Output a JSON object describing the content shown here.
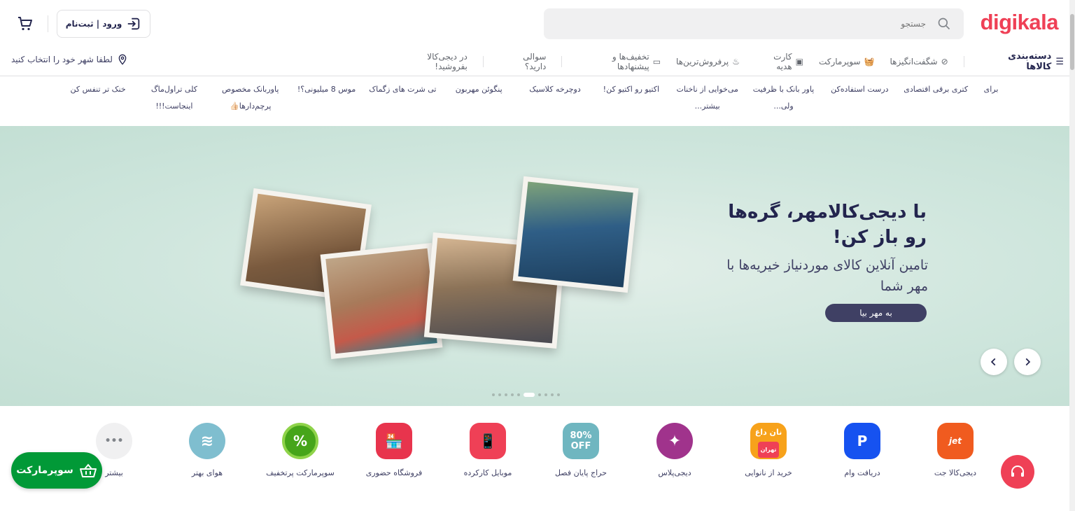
{
  "brand": {
    "logo_text": "digikala",
    "accent": "#ef4056"
  },
  "search": {
    "placeholder": "جستجو"
  },
  "header": {
    "login_label": "ورود | ثبت‌نام"
  },
  "location": {
    "label": "لطفا شهر خود را انتخاب کنید"
  },
  "nav": {
    "categories": "دسته‌بندی کالاها",
    "items": [
      "شگفت‌انگیزها",
      "سوپرمارکت",
      "کارت هدیه",
      "پرفروش‌ترین‌ها",
      "تخفیف‌ها و پیشنهادها",
      "سوالی دارید؟",
      "در دیجی‌کالا بفروشید!"
    ]
  },
  "stories": [
    "خنک تر تنفس کن",
    "کلی تراول‌ماگ اینجاست!!!",
    "پاوربانک مخصوص پرچم‌دارها👍🏻",
    "موس 8 میلیونی؟!",
    "تی شرت های زگماک",
    "پنگوئن مهربون",
    "دوچرخه کلاسیک",
    "اکتیو رو اکتیو کن!",
    "می‌خوایی از ناخنات بیشتر...",
    "پاور بانک با ظرفیت ولی...",
    "درست استفاده‌کن",
    "کتری برقی اقتصادی",
    "برای"
  ],
  "hero": {
    "title": "با دیجی‌کالامهر، گره‌ها رو باز کن!",
    "subtitle": "تامین آنلاین کالای موردنیاز خیریه‌ها با مهر شما",
    "cta": "به مهر بیا",
    "bg": "#cfe6dd"
  },
  "services": [
    {
      "label": "دیجی‌کالا جت",
      "icon": "jet-icon",
      "badge": "jet",
      "color": "#f05b1f"
    },
    {
      "label": "دریافت وام",
      "icon": "loan-icon",
      "badge": "P",
      "color": "#1652f0"
    },
    {
      "label": "خرید از نانوایی",
      "icon": "bakery-icon",
      "badge": "نان داغ",
      "sub_badge": "تهران",
      "color": "#f7a21b"
    },
    {
      "label": "دیجی‌پلاس",
      "icon": "digiplus-icon",
      "badge": "✦",
      "color": "#a0338c"
    },
    {
      "label": "حراج پایان فصل",
      "icon": "sale-icon",
      "badge": "80% OFF",
      "color": "#6fb6c0"
    },
    {
      "label": "موبایل کارکرده",
      "icon": "mobile-icon",
      "badge": "📱",
      "color": "#ef4056"
    },
    {
      "label": "فروشگاه حضوری",
      "icon": "store-icon",
      "badge": "🏪",
      "color": "#e8344d"
    },
    {
      "label": "سوپرمارکت پرتخفیف",
      "icon": "supermarket-discount-icon",
      "badge": "%",
      "color": "#46a51a"
    },
    {
      "label": "هوای بهتر",
      "icon": "air-icon",
      "badge": "≋",
      "color": "#7fbecf"
    },
    {
      "label": "بیشتر",
      "icon": "more-icon",
      "badge": "•••",
      "color": "#f0f0f1"
    }
  ],
  "supermarket_button": {
    "label": "سوپرمارکت",
    "color": "#019937"
  }
}
